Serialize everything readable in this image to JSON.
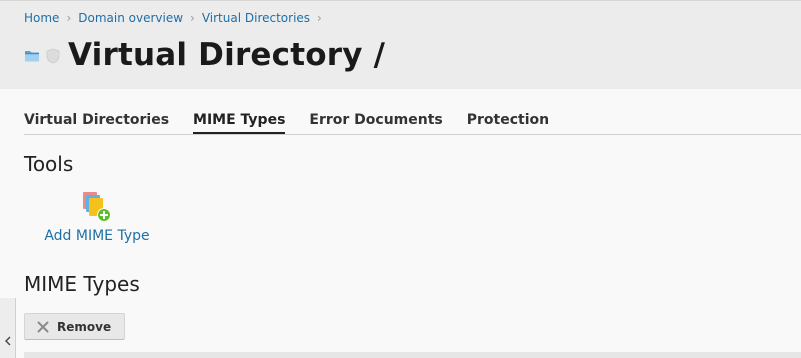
{
  "breadcrumb": {
    "items": [
      "Home",
      "Domain overview",
      "Virtual Directories"
    ]
  },
  "header": {
    "title": "Virtual Directory /",
    "icons": [
      "folder-icon",
      "shield-icon"
    ]
  },
  "tabs": [
    {
      "label": "Virtual Directories",
      "active": false
    },
    {
      "label": "MIME Types",
      "active": true
    },
    {
      "label": "Error Documents",
      "active": false
    },
    {
      "label": "Protection",
      "active": false
    }
  ],
  "tools": {
    "title": "Tools",
    "items": [
      {
        "label": "Add MIME Type",
        "icon": "add-mime-type-icon"
      }
    ]
  },
  "mime_types": {
    "title": "MIME Types",
    "remove_label": "Remove"
  },
  "colors": {
    "link": "#1e6fa8",
    "header_bg": "#ececec",
    "page_bg": "#f9f9f9"
  }
}
